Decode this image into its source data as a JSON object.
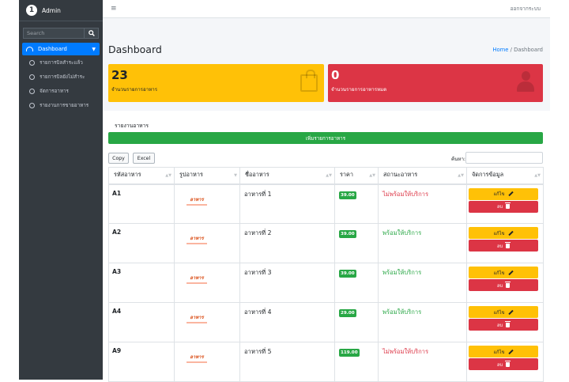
{
  "brand": {
    "logo_letter": "1",
    "name": "Admin"
  },
  "search": {
    "placeholder": "Search",
    "icon": "search-icon"
  },
  "sidebar": {
    "active": {
      "label": "Dashboard",
      "icon": "dashboard-icon"
    },
    "items": [
      {
        "label": "รายการบิลสำระแล้ว"
      },
      {
        "label": "รายการบิลยังไม่สำระ"
      },
      {
        "label": "จัดการอาหาร"
      },
      {
        "label": "รายงานการขายอาหาร"
      }
    ]
  },
  "topbar": {
    "menu_icon": "≡",
    "logout": "ออกจากระบบ"
  },
  "page": {
    "title": "Dashboard"
  },
  "breadcrumb": {
    "home": "Home",
    "separator": "/",
    "current": "Dashboard"
  },
  "stats": {
    "food_count": {
      "value": "23",
      "label": "จำนวนรายการอาหาร",
      "color": "#ffc107",
      "icon": "shopping-bag-icon"
    },
    "sold_out": {
      "value": "0",
      "label": "จำนวนรายการอาหารหมด",
      "color": "#dc3545",
      "icon": "user-icon"
    }
  },
  "report": {
    "title": "รายงานอาหาร",
    "add_button": "เพิ่มรายการอาหาร",
    "copy_button": "Copy",
    "excel_button": "Excel",
    "filter_label": "ค้นหา:"
  },
  "table": {
    "headers": [
      "รหัสอาหาร",
      "รูปอาหาร",
      "ชื่ออาหาร",
      "ราคา",
      "สถานะอาหาร",
      "จัดการข้อมูล"
    ],
    "logo_text": "อาหาร",
    "edit_label": "แก้ไข",
    "delete_label": "ลบ",
    "rows": [
      {
        "code": "A1",
        "name": "อาหารที่ 1",
        "price": "39.00",
        "status": "ไม่พร้อมให้บริการ",
        "available": false
      },
      {
        "code": "A2",
        "name": "อาหารที่ 2",
        "price": "39.00",
        "status": "พร้อมให้บริการ",
        "available": true
      },
      {
        "code": "A3",
        "name": "อาหารที่ 3",
        "price": "39.00",
        "status": "พร้อมให้บริการ",
        "available": true
      },
      {
        "code": "A4",
        "name": "อาหารที่ 4",
        "price": "29.00",
        "status": "พร้อมให้บริการ",
        "available": true
      },
      {
        "code": "A9",
        "name": "อาหารที่ 5",
        "price": "119.00",
        "status": "ไม่พร้อมให้บริการ",
        "available": false
      }
    ]
  },
  "colors": {
    "sidebar": "#343a40",
    "primary": "#007bff",
    "success": "#28a745",
    "warning": "#ffc107",
    "danger": "#dc3545"
  }
}
